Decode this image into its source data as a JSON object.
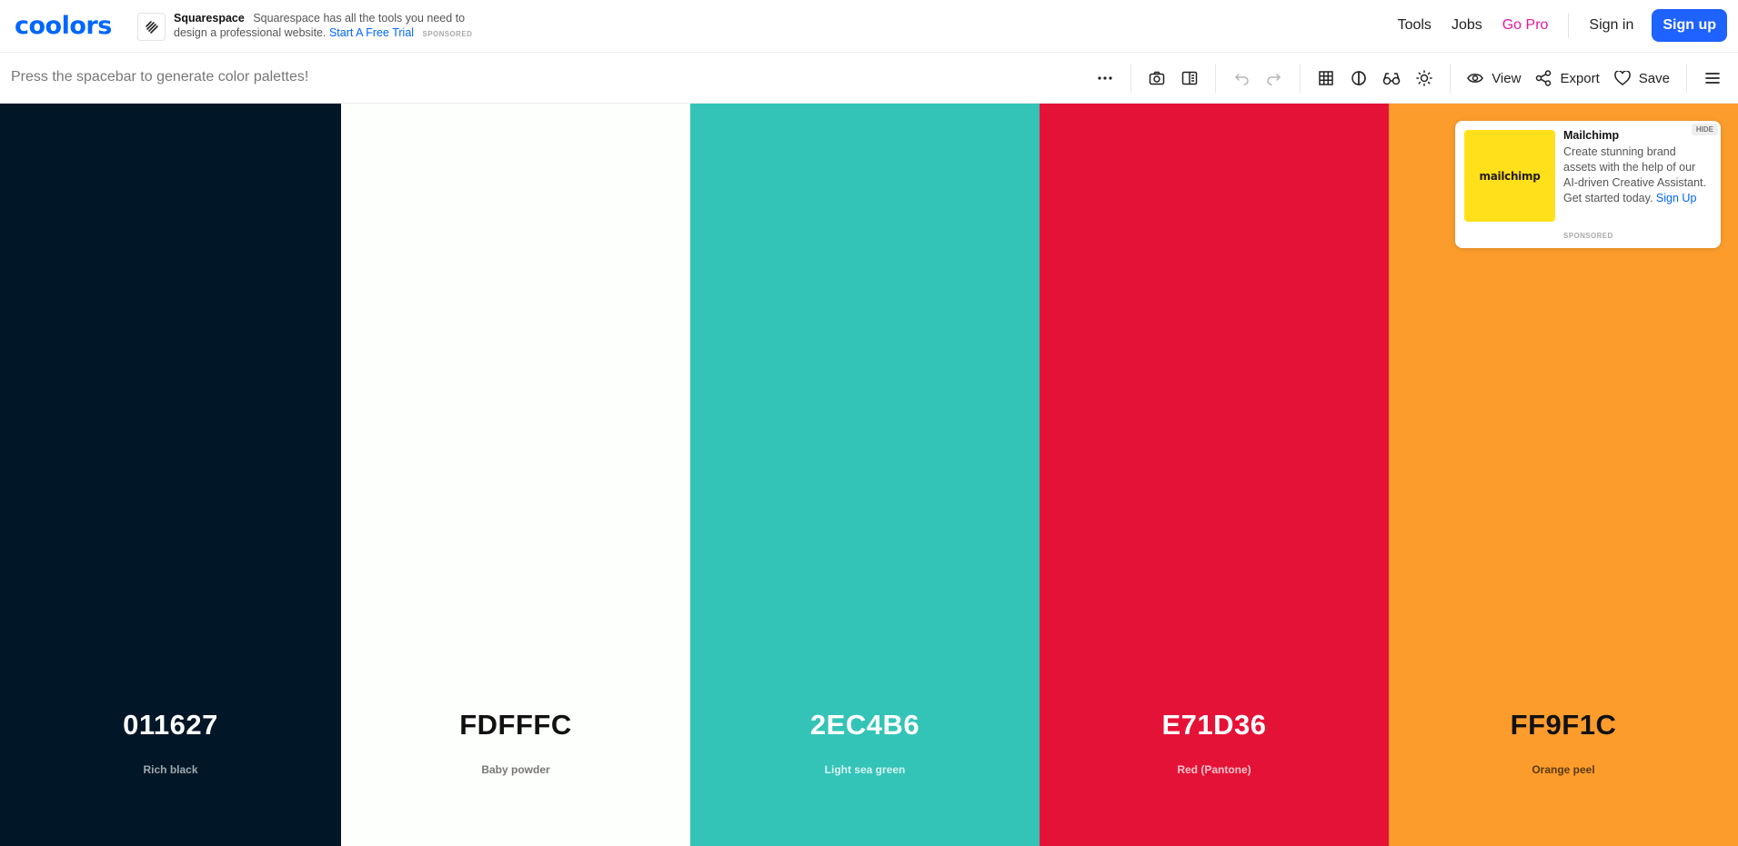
{
  "brand": {
    "logo_text": "coolors",
    "color": "#0066ff"
  },
  "top_ad": {
    "name": "Squarespace",
    "text": "Squarespace has all the tools you need to design a professional website.",
    "cta": "Start A Free Trial",
    "sponsored": "SPONSORED",
    "icon": "squarespace-icon"
  },
  "nav": {
    "tools": "Tools",
    "jobs": "Jobs",
    "go_pro": "Go Pro",
    "sign_in": "Sign in",
    "sign_up": "Sign up",
    "pro_color": "#e31b9e",
    "signup_color": "#1e62ff"
  },
  "toolbar": {
    "hint": "Press the spacebar to generate color palettes!",
    "icons": [
      "more-icon",
      "camera-icon",
      "side-panel-icon",
      "undo-icon",
      "redo-icon",
      "grid-icon",
      "contrast-icon",
      "glasses-icon",
      "sun-icon",
      "eye-icon",
      "share-icon",
      "heart-icon",
      "menu-icon"
    ],
    "view_label": "View",
    "export_label": "Export",
    "save_label": "Save"
  },
  "palette": [
    {
      "hex": "011627",
      "name": "Rich black",
      "bg": "#011627",
      "text_color": "#ffffff",
      "name_color": "#a0a8b0"
    },
    {
      "hex": "FDFFFC",
      "name": "Baby powder",
      "bg": "#fdfffc",
      "text_color": "#111111",
      "name_color": "#777777"
    },
    {
      "hex": "2EC4B6",
      "name": "Light sea green",
      "bg": "#33c4b7",
      "text_color": "#ffffff",
      "name_color": "#d8f3f0"
    },
    {
      "hex": "E71D36",
      "name": "Red (Pantone)",
      "bg": "#e51237",
      "text_color": "#ffffff",
      "name_color": "#f7c3cb"
    },
    {
      "hex": "FF9F1C",
      "name": "Orange peel",
      "bg": "#fb9c2c",
      "text_color": "#111111",
      "name_color": "#5b3a10"
    }
  ],
  "side_ad": {
    "title": "Mailchimp",
    "logo_text": "mailchimp",
    "logo_color": "#ffe01b",
    "body": "Create stunning brand assets with the help of our AI-driven Creative Assistant. Get started today.",
    "cta": "Sign Up",
    "sponsored": "SPONSORED",
    "hide": "HIDE"
  }
}
